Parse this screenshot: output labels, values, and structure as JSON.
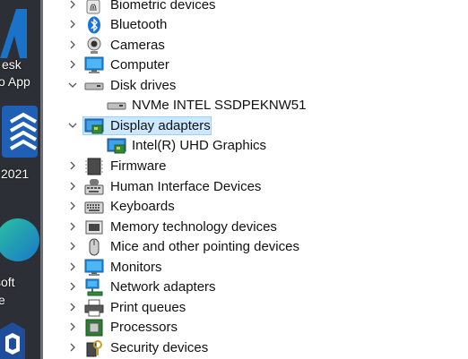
{
  "desktop": {
    "icons": [
      {
        "label_lines": [
          "esk",
          "o App"
        ]
      },
      {
        "label_lines": [
          "2021"
        ]
      },
      {
        "label_lines": [
          "soft",
          "e"
        ]
      }
    ]
  },
  "tree": {
    "items": [
      {
        "label": "Biometric devices",
        "icon": "fingerprint-icon",
        "expanded": false,
        "level": 0
      },
      {
        "label": "Bluetooth",
        "icon": "bluetooth-icon",
        "expanded": false,
        "level": 0
      },
      {
        "label": "Cameras",
        "icon": "camera-icon",
        "expanded": false,
        "level": 0
      },
      {
        "label": "Computer",
        "icon": "computer-icon",
        "expanded": false,
        "level": 0
      },
      {
        "label": "Disk drives",
        "icon": "disk-drive-icon",
        "expanded": true,
        "level": 0
      },
      {
        "label": "NVMe INTEL SSDPEKNW51",
        "icon": "disk-drive-icon",
        "level": 1
      },
      {
        "label": "Display adapters",
        "icon": "display-adapter-icon",
        "expanded": true,
        "level": 0,
        "selected": true
      },
      {
        "label": "Intel(R) UHD Graphics",
        "icon": "display-adapter-icon",
        "level": 1
      },
      {
        "label": "Firmware",
        "icon": "firmware-icon",
        "expanded": false,
        "level": 0
      },
      {
        "label": "Human Interface Devices",
        "icon": "hid-icon",
        "expanded": false,
        "level": 0
      },
      {
        "label": "Keyboards",
        "icon": "keyboard-icon",
        "expanded": false,
        "level": 0
      },
      {
        "label": "Memory technology devices",
        "icon": "memory-icon",
        "expanded": false,
        "level": 0
      },
      {
        "label": "Mice and other pointing devices",
        "icon": "mouse-icon",
        "expanded": false,
        "level": 0
      },
      {
        "label": "Monitors",
        "icon": "monitor-icon",
        "expanded": false,
        "level": 0
      },
      {
        "label": "Network adapters",
        "icon": "network-adapter-icon",
        "expanded": false,
        "level": 0
      },
      {
        "label": "Print queues",
        "icon": "printer-icon",
        "expanded": false,
        "level": 0
      },
      {
        "label": "Processors",
        "icon": "processor-icon",
        "expanded": false,
        "level": 0
      },
      {
        "label": "Security devices",
        "icon": "security-device-icon",
        "expanded": false,
        "level": 0
      }
    ]
  },
  "colors": {
    "selection_bg": "#cce8ff",
    "selection_border": "#99d1ff",
    "desktop_bg": "#2c2f35"
  }
}
